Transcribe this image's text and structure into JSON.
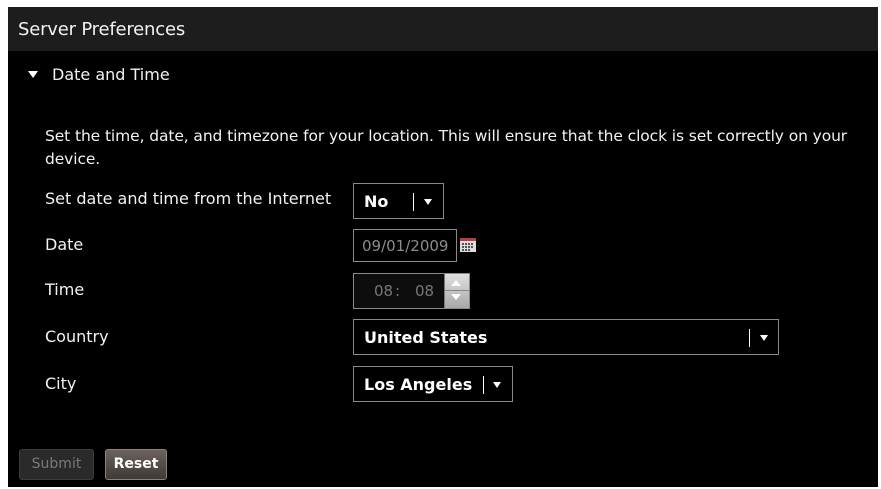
{
  "header": {
    "title": "Server Preferences"
  },
  "section": {
    "title": "Date and Time",
    "expanded_icon": "triangle-down-icon"
  },
  "description": "Set the time, date, and timezone for your location.  This will ensure that the clock is set correctly on your device.",
  "form": {
    "internet_time": {
      "label": "Set date and time from the Internet",
      "value": "No"
    },
    "date": {
      "label": "Date",
      "value": "09/01/2009",
      "icon": "calendar-icon"
    },
    "time": {
      "label": "Time",
      "hour": "08",
      "separator": ":",
      "minute": "08"
    },
    "country": {
      "label": "Country",
      "value": "United States"
    },
    "city": {
      "label": "City",
      "value": "Los Angeles"
    }
  },
  "buttons": {
    "submit": "Submit",
    "reset": "Reset"
  },
  "colors": {
    "background": "#000000",
    "titlebar": "#1d1d1d",
    "disabled_text": "#7a7a7a"
  }
}
